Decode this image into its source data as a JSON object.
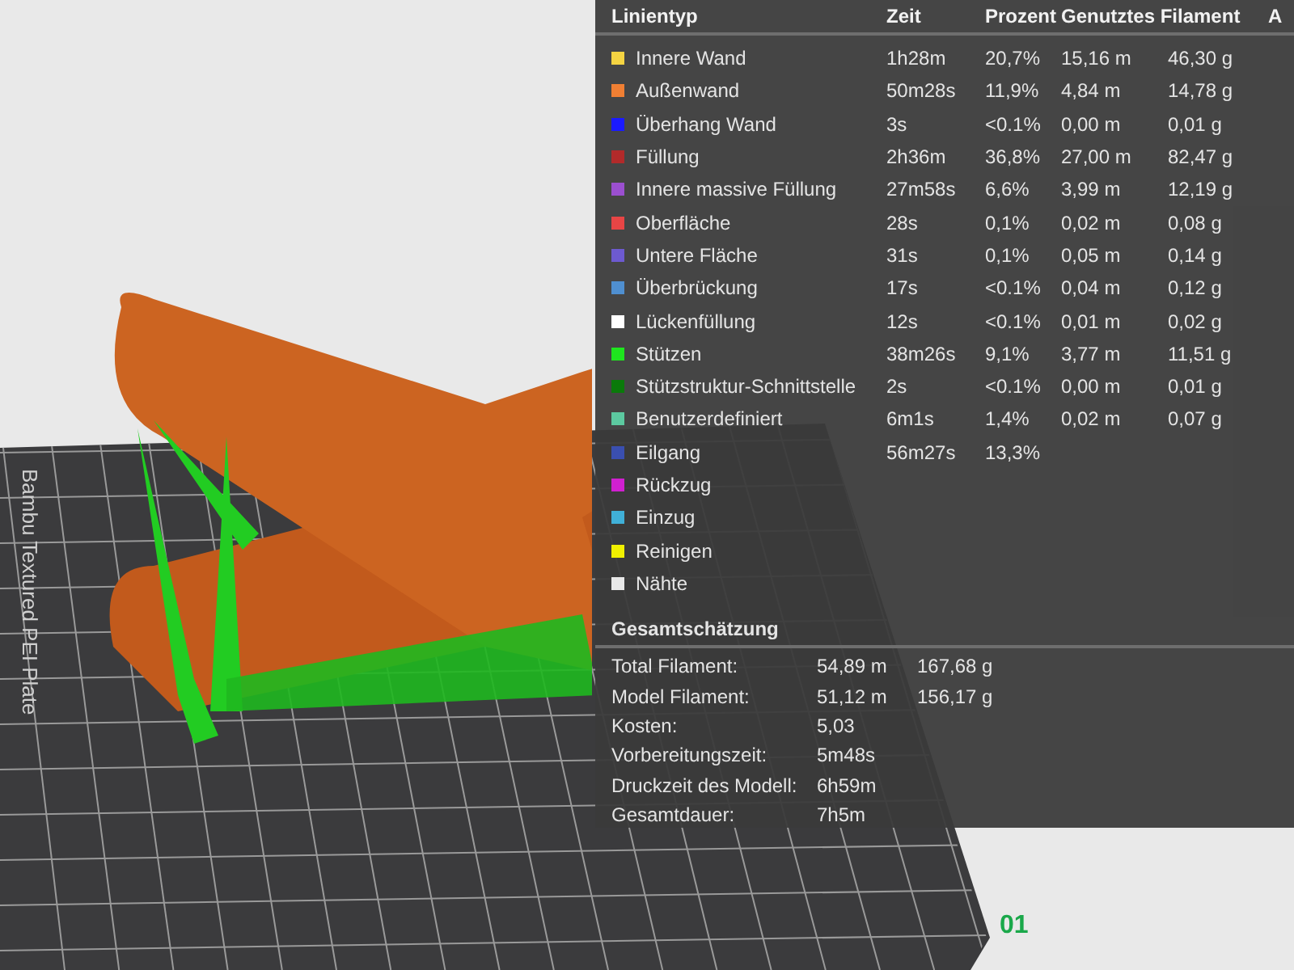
{
  "viewport": {
    "plate_label": "Bambu Textured PEI Plate",
    "plate_number": "01"
  },
  "legend": {
    "columns": [
      "Linientyp",
      "Zeit",
      "Prozent",
      "Genutztes Filament",
      "A"
    ],
    "rows": [
      {
        "name": "Innere Wand",
        "color": "#f5d442",
        "time": "1h28m",
        "percent": "20,7%",
        "length": "15,16 m",
        "weight": "46,30 g"
      },
      {
        "name": "Außenwand",
        "color": "#f07f33",
        "time": "50m28s",
        "percent": "11,9%",
        "length": "4,84 m",
        "weight": "14,78 g"
      },
      {
        "name": "Überhang Wand",
        "color": "#1a1aff",
        "time": "3s",
        "percent": "<0.1%",
        "length": "0,00 m",
        "weight": "0,01 g"
      },
      {
        "name": "Füllung",
        "color": "#b22a2a",
        "time": "2h36m",
        "percent": "36,8%",
        "length": "27,00 m",
        "weight": "82,47 g"
      },
      {
        "name": "Innere massive Füllung",
        "color": "#9b4fd0",
        "time": "27m58s",
        "percent": "6,6%",
        "length": "3,99 m",
        "weight": "12,19 g"
      },
      {
        "name": "Oberfläche",
        "color": "#e84545",
        "time": "28s",
        "percent": "0,1%",
        "length": "0,02 m",
        "weight": "0,08 g"
      },
      {
        "name": "Untere Fläche",
        "color": "#6d5ad0",
        "time": "31s",
        "percent": "0,1%",
        "length": "0,05 m",
        "weight": "0,14 g"
      },
      {
        "name": "Überbrückung",
        "color": "#4f8fd0",
        "time": "17s",
        "percent": "<0.1%",
        "length": "0,04 m",
        "weight": "0,12 g"
      },
      {
        "name": "Lückenfüllung",
        "color": "#ffffff",
        "time": "12s",
        "percent": "<0.1%",
        "length": "0,01 m",
        "weight": "0,02 g"
      },
      {
        "name": "Stützen",
        "color": "#1ee51e",
        "time": "38m26s",
        "percent": "9,1%",
        "length": "3,77 m",
        "weight": "11,51 g"
      },
      {
        "name": "Stützstruktur-Schnittstelle",
        "color": "#0a7a0a",
        "time": "2s",
        "percent": "<0.1%",
        "length": "0,00 m",
        "weight": "0,01 g"
      },
      {
        "name": "Benutzerdefiniert",
        "color": "#5cc9a0",
        "time": "6m1s",
        "percent": "1,4%",
        "length": "0,02 m",
        "weight": "0,07 g"
      },
      {
        "name": "Eilgang",
        "color": "#3a4fb0",
        "time": "56m27s",
        "percent": "13,3%"
      },
      {
        "name": "Rückzug",
        "color": "#d020d0"
      },
      {
        "name": "Einzug",
        "color": "#40b0d8"
      },
      {
        "name": "Reinigen",
        "color": "#f0f000"
      },
      {
        "name": "Nähte",
        "color": "#e8e8e8"
      }
    ]
  },
  "summary": {
    "title": "Gesamtschätzung",
    "rows": [
      {
        "label": "Total Filament:",
        "value": "54,89 m",
        "extra": "167,68 g"
      },
      {
        "label": "Model Filament:",
        "value": "51,12 m",
        "extra": "156,17 g"
      },
      {
        "label": "Kosten:",
        "value": "5,03"
      },
      {
        "label": "Vorbereitungszeit:",
        "value": "5m48s"
      },
      {
        "label": "Druckzeit des Modell:",
        "value": "6h59m"
      },
      {
        "label": "Gesamtdauer:",
        "value": "7h5m"
      }
    ]
  }
}
